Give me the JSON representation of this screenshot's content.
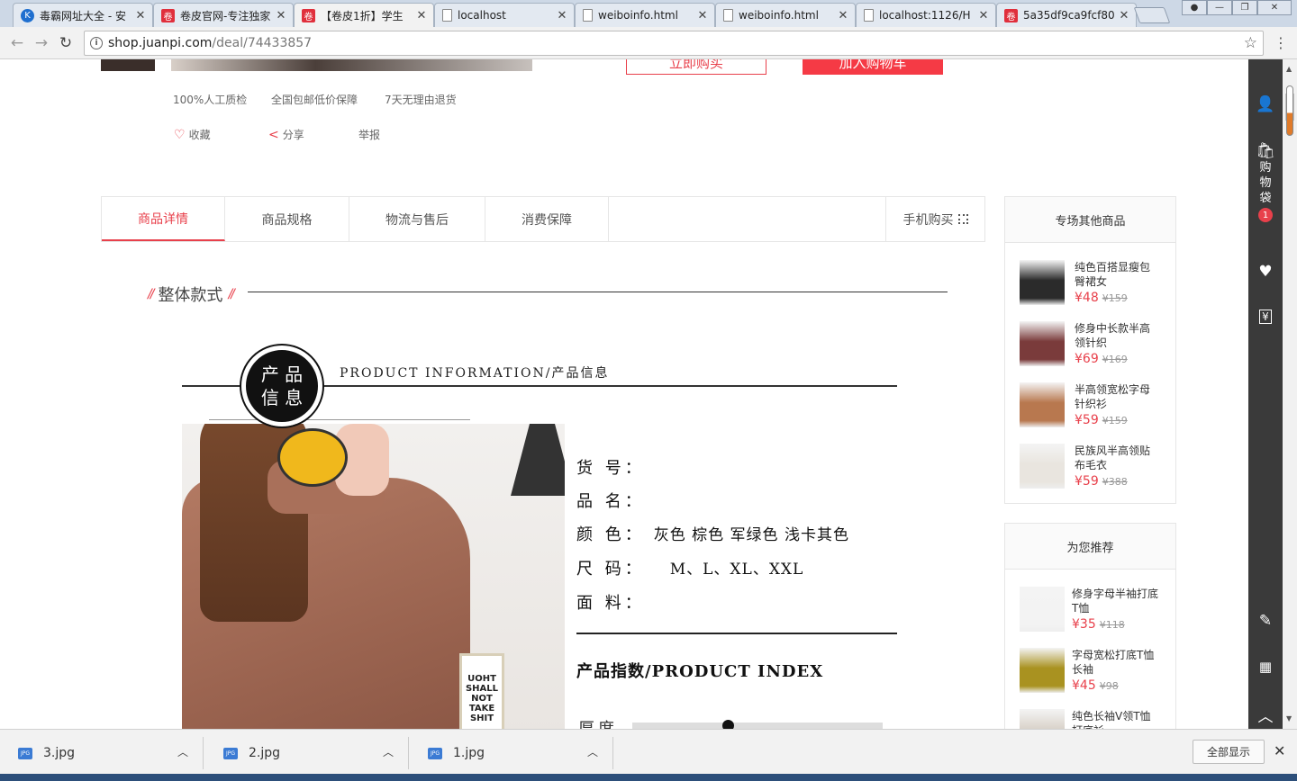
{
  "browser": {
    "tabs": [
      {
        "title": "毒霸网址大全 - 安",
        "icon": "k-logo-icon",
        "active": false
      },
      {
        "title": "卷皮官网-专注独家",
        "icon": "juanpi-icon",
        "active": false
      },
      {
        "title": "【卷皮1折】学生",
        "icon": "juanpi-icon",
        "active": true
      },
      {
        "title": "localhost",
        "icon": "page-icon",
        "active": false
      },
      {
        "title": "weiboinfo.html",
        "icon": "page-icon",
        "active": false
      },
      {
        "title": "weiboinfo.html",
        "icon": "page-icon",
        "active": false
      },
      {
        "title": "localhost:1126/H",
        "icon": "page-icon",
        "active": false
      },
      {
        "title": "5a35df9ca9fcf80",
        "icon": "juanpi-icon",
        "active": false
      }
    ],
    "url_host": "shop.juanpi.com",
    "url_path": "/deal/74433857"
  },
  "product": {
    "buy_now": "立即购买",
    "add_cart": "加入购物车",
    "guarantees": [
      "100%人工质检",
      "全国包邮低价保障",
      "7天无理由退货"
    ],
    "actions": {
      "favorite": "收藏",
      "share": "分享",
      "report": "举报"
    }
  },
  "detail_tabs": [
    {
      "label": "商品详情",
      "active": true
    },
    {
      "label": "商品规格",
      "active": false
    },
    {
      "label": "物流与售后",
      "active": false
    },
    {
      "label": "消费保障",
      "active": false
    }
  ],
  "mobile_buy": "手机购买",
  "section_title": "整体款式",
  "info_image": {
    "badge_line1": "产 品",
    "badge_line2": "信 息",
    "header_en": "PRODUCT INFORMATION/产品信息",
    "frame_text": "UOHT\nSHALL\nNOT\nTAKE\nSHIT",
    "spec_labels": [
      "货 号：",
      "品 名：",
      "颜 色：",
      "尺 码：",
      "面 料："
    ],
    "color_value": "灰色  棕色  军绿色 浅卡其色",
    "size_value": "M、L、XL、XXL",
    "index_title": "产品指数/PRODUCT INDEX",
    "thickness_label": "厚度",
    "thickness_level": 0.38
  },
  "sidebar": {
    "special_title": "专场其他商品",
    "special_items": [
      {
        "name": "纯色百搭显瘦包臀裙女",
        "price": "¥48",
        "old_price": "¥159",
        "thumb_color": "#2b2b2b"
      },
      {
        "name": "修身中长款半高领针织",
        "price": "¥69",
        "old_price": "¥169",
        "thumb_color": "#7a3b3b"
      },
      {
        "name": "半高领宽松字母针织衫",
        "price": "¥59",
        "old_price": "¥159",
        "thumb_color": "#b8784f"
      },
      {
        "name": "民族风半高领贴布毛衣",
        "price": "¥59",
        "old_price": "¥388",
        "thumb_color": "#e9e5df"
      }
    ],
    "recommend_title": "为您推荐",
    "recommend_items": [
      {
        "name": "修身字母半袖打底T恤",
        "price": "¥35",
        "old_price": "¥118",
        "thumb_color": "#f3f3f3"
      },
      {
        "name": "字母宽松打底T恤长袖",
        "price": "¥45",
        "old_price": "¥98",
        "thumb_color": "#a99220"
      },
      {
        "name": "纯色长袖V领T恤打底衫",
        "price": "",
        "old_price": "",
        "thumb_color": "#d9d2c9"
      }
    ]
  },
  "side_tools": {
    "cart_label": "购物袋",
    "cart_count": "1"
  },
  "downloads": {
    "files": [
      "3.jpg",
      "2.jpg",
      "1.jpg"
    ],
    "file_badge": "JPG",
    "show_all": "全部显示"
  },
  "colors": {
    "accent": "#e8404b",
    "sidebar_dark": "#3a3a3a"
  }
}
